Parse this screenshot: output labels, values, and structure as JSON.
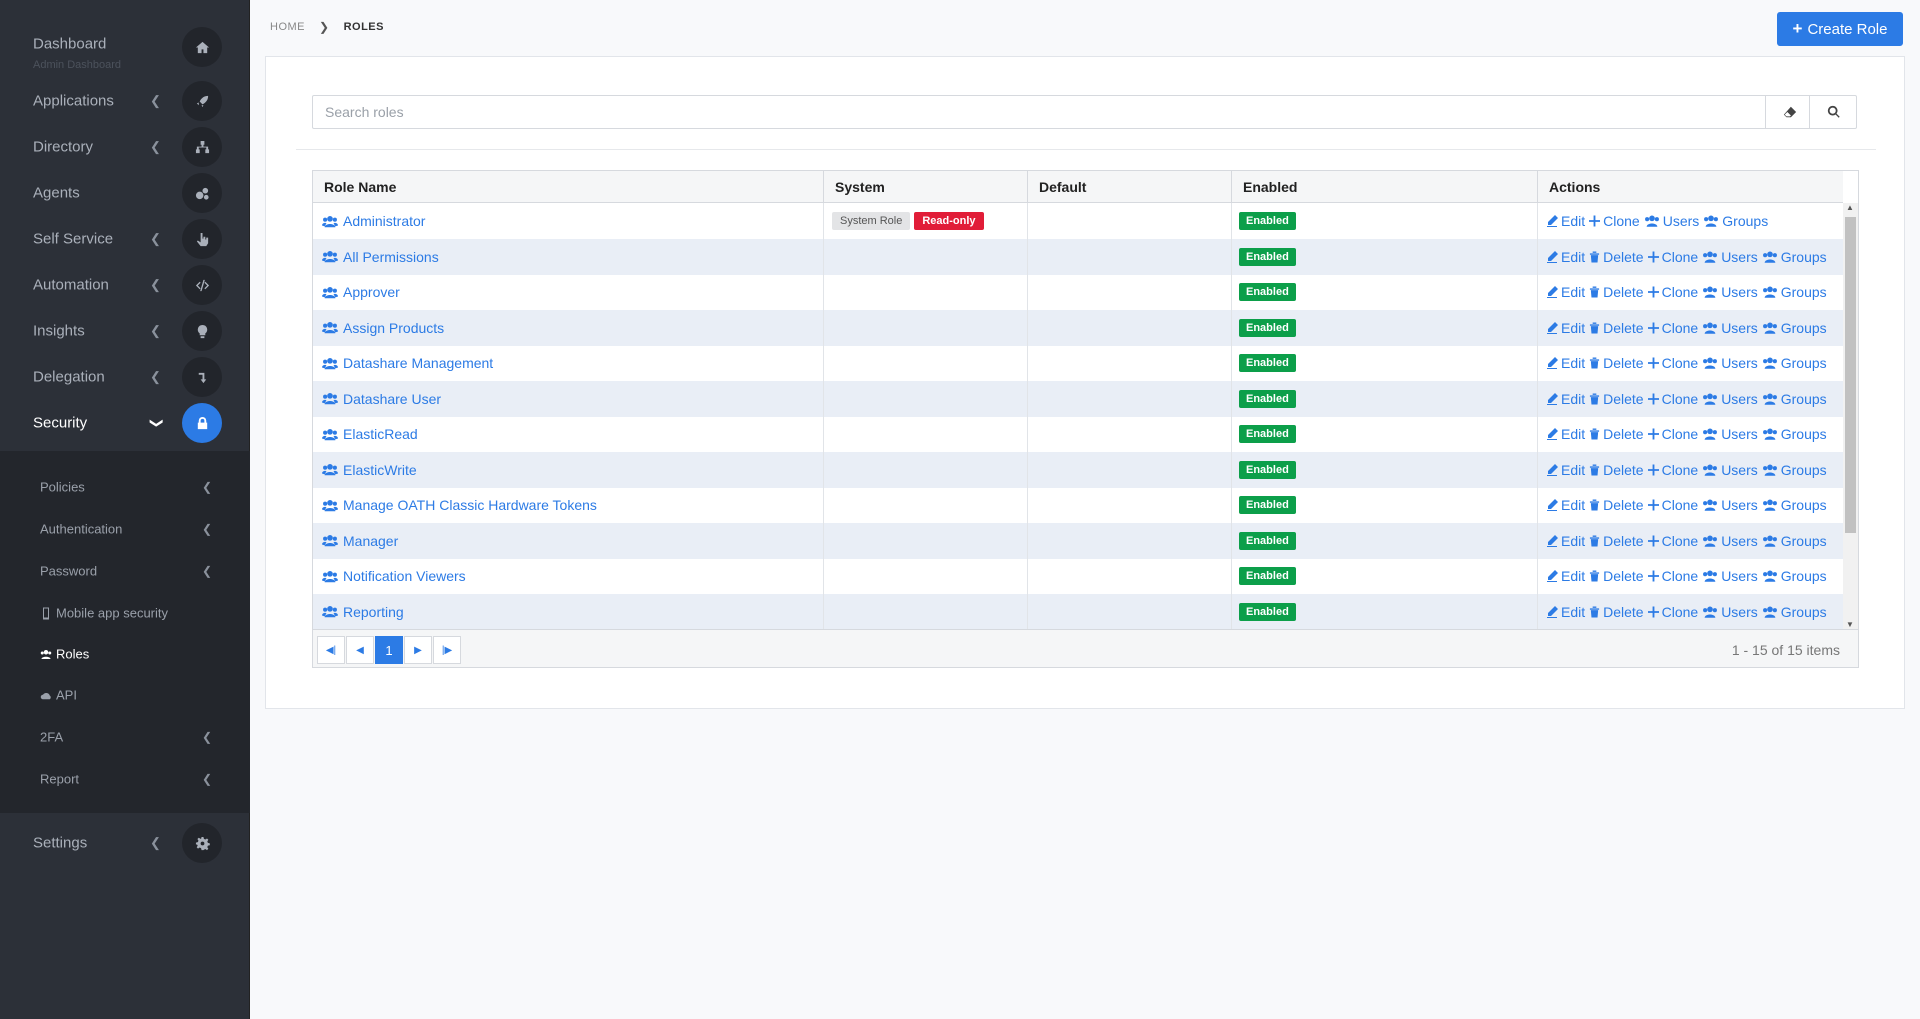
{
  "nav": {
    "dashboard": {
      "label": "Dashboard",
      "sub": "Admin Dashboard"
    },
    "items": [
      {
        "label": "Applications",
        "icon": "rocket-icon"
      },
      {
        "label": "Directory",
        "icon": "sitemap-icon"
      },
      {
        "label": "Agents",
        "icon": "cogs-icon"
      },
      {
        "label": "Self Service",
        "icon": "hand-pointer-icon"
      },
      {
        "label": "Automation",
        "icon": "code-icon"
      },
      {
        "label": "Insights",
        "icon": "lightbulb-icon"
      },
      {
        "label": "Delegation",
        "icon": "level-down-icon"
      },
      {
        "label": "Security",
        "icon": "lock-icon"
      }
    ],
    "security_sub": [
      {
        "label": "Policies"
      },
      {
        "label": "Authentication"
      },
      {
        "label": "Password"
      },
      {
        "label": "Mobile app security"
      },
      {
        "label": "Roles"
      },
      {
        "label": "API"
      },
      {
        "label": "2FA"
      },
      {
        "label": "Report"
      }
    ],
    "settings": {
      "label": "Settings",
      "icon": "gear-icon"
    }
  },
  "breadcrumb": {
    "home": "HOME",
    "current": "ROLES"
  },
  "create_button": "Create Role",
  "search": {
    "placeholder": "Search roles"
  },
  "table": {
    "columns": [
      "Role Name",
      "System",
      "Default",
      "Enabled",
      "Actions"
    ],
    "system_badge": "System Role",
    "readonly_badge": "Read-only",
    "enabled_badge": "Enabled",
    "actions": {
      "edit": "Edit",
      "delete": "Delete",
      "clone": "Clone",
      "users": "Users",
      "groups": "Groups"
    },
    "rows": [
      {
        "name": "Administrator"
      },
      {
        "name": "All Permissions"
      },
      {
        "name": "Approver"
      },
      {
        "name": "Assign Products"
      },
      {
        "name": "Datashare Management"
      },
      {
        "name": "Datashare User"
      },
      {
        "name": "ElasticRead"
      },
      {
        "name": "ElasticWrite"
      },
      {
        "name": "Manage OATH Classic Hardware Tokens"
      },
      {
        "name": "Manager"
      },
      {
        "name": "Notification Viewers"
      },
      {
        "name": "Reporting"
      }
    ]
  },
  "pager": {
    "current_page": "1",
    "info": "1 - 15 of 15 items"
  },
  "colors": {
    "accent": "#2c7be5",
    "enabled": "#0c9f4a",
    "readonly": "#e11d38",
    "sidebar": "#2c3038"
  }
}
